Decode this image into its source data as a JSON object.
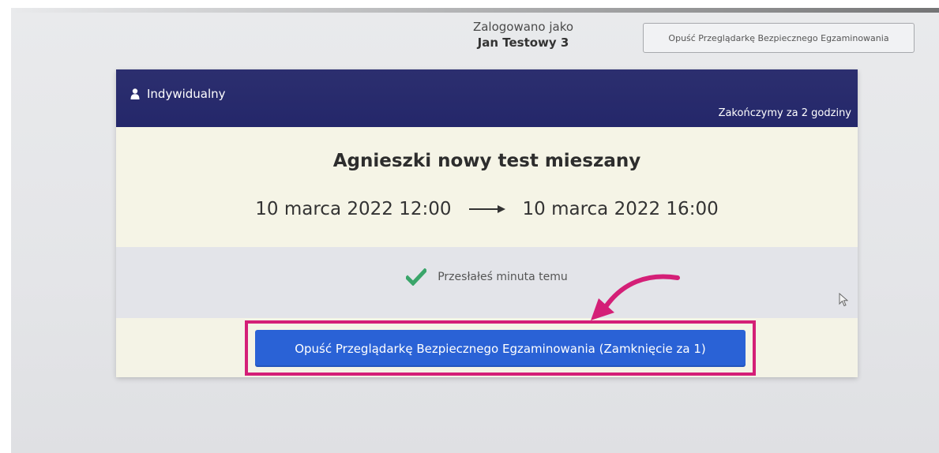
{
  "header": {
    "login_caption": "Zalogowano jako",
    "user_name": "Jan Testowy 3",
    "exit_button_label": "Opuść Przeglądarkę Bezpiecznego Egzaminowania"
  },
  "card": {
    "mode_label": "Indywidualny",
    "mode_icon": "user-icon",
    "time_remaining": "Zakończymy za 2 godziny",
    "test_title": "Agnieszki nowy test mieszany",
    "start_datetime": "10 marca 2022 12:00",
    "end_datetime": "10 marca 2022 16:00",
    "status_icon": "check-icon",
    "status_text": "Przesłałeś minuta temu",
    "main_exit_label": "Opuść Przeglądarkę Bezpiecznego Egzaminowania (Zamknięcie za 1)"
  },
  "colors": {
    "header_bg": "#24276a",
    "primary_button": "#2a62d6",
    "highlight": "#d41f77",
    "success": "#3aa56a"
  }
}
